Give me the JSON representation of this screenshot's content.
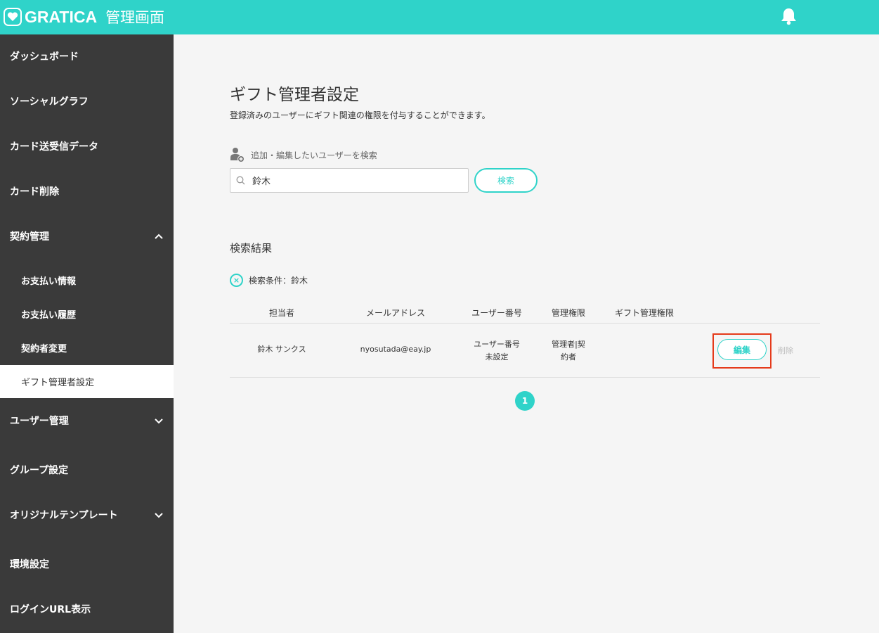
{
  "header": {
    "logo_text": "GRATICA",
    "subtitle": "管理画面",
    "accent_color": "#2fd3c9"
  },
  "sidebar": {
    "items": [
      {
        "label": "ダッシュボード"
      },
      {
        "label": "ソーシャルグラフ"
      },
      {
        "label": "カード送受信データ"
      },
      {
        "label": "カード削除"
      },
      {
        "label": "契約管理",
        "expanded": true
      },
      {
        "label": "お支払い情報"
      },
      {
        "label": "お支払い履歴"
      },
      {
        "label": "契約者変更"
      },
      {
        "label": "ギフト管理者設定",
        "active": true
      },
      {
        "label": "ユーザー管理",
        "expanded": false
      },
      {
        "label": "グループ設定"
      },
      {
        "label": "オリジナルテンプレート",
        "expanded": false
      },
      {
        "label": "環境設定"
      },
      {
        "label": "ログインURL表示"
      }
    ]
  },
  "main": {
    "title": "ギフト管理者設定",
    "description": "登録済みのユーザーにギフト関連の権限を付与することができます。",
    "search": {
      "label": "追加・編集したいユーザーを検索",
      "value": "鈴木",
      "button": "検索"
    },
    "results": {
      "title": "検索結果",
      "condition": "検索条件：鈴木",
      "columns": [
        "担当者",
        "メールアドレス",
        "ユーザー番号",
        "管理権限",
        "ギフト管理権限"
      ],
      "rows": [
        {
          "name": "鈴木 サンクス",
          "email": "nyosutada@eay.jp",
          "user_number_line1": "ユーザー番号",
          "user_number_line2": "未設定",
          "admin_line1": "管理者|契",
          "admin_line2": "約者",
          "gift_admin": "",
          "edit": "編集",
          "delete": "削除"
        }
      ]
    },
    "pagination": {
      "current": "1"
    }
  }
}
